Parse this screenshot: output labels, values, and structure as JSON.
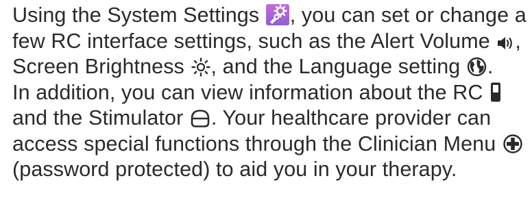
{
  "paragraph": {
    "l1_a": "Using the System Settings",
    "l1_b": ", you can set or change a",
    "l2_a": "few RC interface settings, such as the Alert Volume",
    "l2_b": ",",
    "l3_a": "Screen Brightness",
    "l3_b": ", and the Language setting",
    "l3_c": ".",
    "l4_a": "In addition, you can view information about the RC",
    "l5_a": "and the Stimulator",
    "l5_b": ". Your healthcare provider can",
    "l6_a": "access special functions through the Clinician Menu",
    "l7_a": "(password protected) to aid you in your therapy."
  },
  "icons": {
    "system_settings": "system-settings-icon",
    "alert_volume": "speaker-volume-icon",
    "screen_brightness": "sun-brightness-icon",
    "language": "globe-icon",
    "remote_control": "remote-control-icon",
    "stimulator": "stimulator-icon",
    "clinician_menu": "plus-circle-icon"
  },
  "colors": {
    "text": "#2a2a2a",
    "settings_icon_bg_top": "#c56ad8",
    "settings_icon_bg_bottom": "#8f5fd1"
  }
}
